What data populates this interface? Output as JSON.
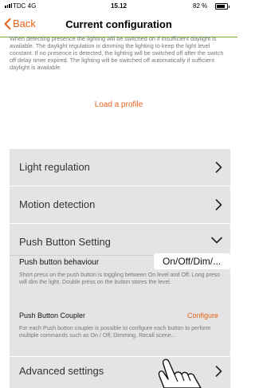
{
  "status_bar": {
    "carrier": "TDC 4G",
    "time": "15.12",
    "battery": "82 %",
    "battery_level": 0.82
  },
  "nav": {
    "back_label": "Back",
    "title": "Current configuration"
  },
  "description": "When detecting presence the lighting will be switched on if insufficient daylight is available. The daylight regulation is dimming the lighting to keep the light level constant. If no presence is detected, the lighting will be switched off after the switch off delay timer expired. The lighting will be switched off automatically if sufficient daylight is available.",
  "load_profile_label": "Load a profile",
  "sections": {
    "light_regulation": "Light regulation",
    "motion_detection": "Motion detection",
    "push_button_setting": "Push Button Setting",
    "advanced_settings": "Advanced settings"
  },
  "push_button": {
    "behaviour_label": "Push button behaviour",
    "behaviour_value": "On/Off/Dim/...",
    "behaviour_description": "Short press on the push button is toggling between On level and Off. Long press will dim the light. Double press on the button stores the level.",
    "coupler_label": "Push Button Coupler",
    "coupler_action": "Configure",
    "coupler_description": "For each Push button coupler is possible to configure each button to perform multiple commands such as On / Off, Dimming, Recall scene..."
  },
  "colors": {
    "accent": "#e8621a",
    "nav_border": "#6bb235",
    "panel_bg": "#e4e4e4"
  },
  "icons": {
    "back": "chevron-left-icon",
    "section_collapsed": "chevron-right-icon",
    "section_expanded": "chevron-down-icon",
    "pointer": "hand-pointer-icon"
  }
}
